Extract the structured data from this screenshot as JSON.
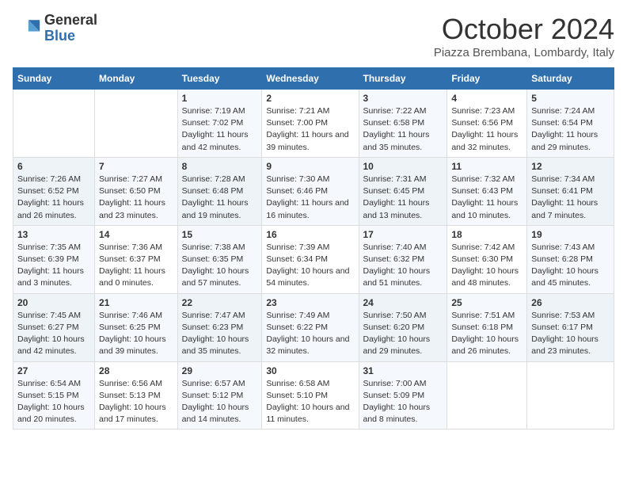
{
  "header": {
    "logo_general": "General",
    "logo_blue": "Blue",
    "month_title": "October 2024",
    "location": "Piazza Brembana, Lombardy, Italy"
  },
  "days_of_week": [
    "Sunday",
    "Monday",
    "Tuesday",
    "Wednesday",
    "Thursday",
    "Friday",
    "Saturday"
  ],
  "weeks": [
    [
      {
        "day": "",
        "info": ""
      },
      {
        "day": "",
        "info": ""
      },
      {
        "day": "1",
        "info": "Sunrise: 7:19 AM\nSunset: 7:02 PM\nDaylight: 11 hours and 42 minutes."
      },
      {
        "day": "2",
        "info": "Sunrise: 7:21 AM\nSunset: 7:00 PM\nDaylight: 11 hours and 39 minutes."
      },
      {
        "day": "3",
        "info": "Sunrise: 7:22 AM\nSunset: 6:58 PM\nDaylight: 11 hours and 35 minutes."
      },
      {
        "day": "4",
        "info": "Sunrise: 7:23 AM\nSunset: 6:56 PM\nDaylight: 11 hours and 32 minutes."
      },
      {
        "day": "5",
        "info": "Sunrise: 7:24 AM\nSunset: 6:54 PM\nDaylight: 11 hours and 29 minutes."
      }
    ],
    [
      {
        "day": "6",
        "info": "Sunrise: 7:26 AM\nSunset: 6:52 PM\nDaylight: 11 hours and 26 minutes."
      },
      {
        "day": "7",
        "info": "Sunrise: 7:27 AM\nSunset: 6:50 PM\nDaylight: 11 hours and 23 minutes."
      },
      {
        "day": "8",
        "info": "Sunrise: 7:28 AM\nSunset: 6:48 PM\nDaylight: 11 hours and 19 minutes."
      },
      {
        "day": "9",
        "info": "Sunrise: 7:30 AM\nSunset: 6:46 PM\nDaylight: 11 hours and 16 minutes."
      },
      {
        "day": "10",
        "info": "Sunrise: 7:31 AM\nSunset: 6:45 PM\nDaylight: 11 hours and 13 minutes."
      },
      {
        "day": "11",
        "info": "Sunrise: 7:32 AM\nSunset: 6:43 PM\nDaylight: 11 hours and 10 minutes."
      },
      {
        "day": "12",
        "info": "Sunrise: 7:34 AM\nSunset: 6:41 PM\nDaylight: 11 hours and 7 minutes."
      }
    ],
    [
      {
        "day": "13",
        "info": "Sunrise: 7:35 AM\nSunset: 6:39 PM\nDaylight: 11 hours and 3 minutes."
      },
      {
        "day": "14",
        "info": "Sunrise: 7:36 AM\nSunset: 6:37 PM\nDaylight: 11 hours and 0 minutes."
      },
      {
        "day": "15",
        "info": "Sunrise: 7:38 AM\nSunset: 6:35 PM\nDaylight: 10 hours and 57 minutes."
      },
      {
        "day": "16",
        "info": "Sunrise: 7:39 AM\nSunset: 6:34 PM\nDaylight: 10 hours and 54 minutes."
      },
      {
        "day": "17",
        "info": "Sunrise: 7:40 AM\nSunset: 6:32 PM\nDaylight: 10 hours and 51 minutes."
      },
      {
        "day": "18",
        "info": "Sunrise: 7:42 AM\nSunset: 6:30 PM\nDaylight: 10 hours and 48 minutes."
      },
      {
        "day": "19",
        "info": "Sunrise: 7:43 AM\nSunset: 6:28 PM\nDaylight: 10 hours and 45 minutes."
      }
    ],
    [
      {
        "day": "20",
        "info": "Sunrise: 7:45 AM\nSunset: 6:27 PM\nDaylight: 10 hours and 42 minutes."
      },
      {
        "day": "21",
        "info": "Sunrise: 7:46 AM\nSunset: 6:25 PM\nDaylight: 10 hours and 39 minutes."
      },
      {
        "day": "22",
        "info": "Sunrise: 7:47 AM\nSunset: 6:23 PM\nDaylight: 10 hours and 35 minutes."
      },
      {
        "day": "23",
        "info": "Sunrise: 7:49 AM\nSunset: 6:22 PM\nDaylight: 10 hours and 32 minutes."
      },
      {
        "day": "24",
        "info": "Sunrise: 7:50 AM\nSunset: 6:20 PM\nDaylight: 10 hours and 29 minutes."
      },
      {
        "day": "25",
        "info": "Sunrise: 7:51 AM\nSunset: 6:18 PM\nDaylight: 10 hours and 26 minutes."
      },
      {
        "day": "26",
        "info": "Sunrise: 7:53 AM\nSunset: 6:17 PM\nDaylight: 10 hours and 23 minutes."
      }
    ],
    [
      {
        "day": "27",
        "info": "Sunrise: 6:54 AM\nSunset: 5:15 PM\nDaylight: 10 hours and 20 minutes."
      },
      {
        "day": "28",
        "info": "Sunrise: 6:56 AM\nSunset: 5:13 PM\nDaylight: 10 hours and 17 minutes."
      },
      {
        "day": "29",
        "info": "Sunrise: 6:57 AM\nSunset: 5:12 PM\nDaylight: 10 hours and 14 minutes."
      },
      {
        "day": "30",
        "info": "Sunrise: 6:58 AM\nSunset: 5:10 PM\nDaylight: 10 hours and 11 minutes."
      },
      {
        "day": "31",
        "info": "Sunrise: 7:00 AM\nSunset: 5:09 PM\nDaylight: 10 hours and 8 minutes."
      },
      {
        "day": "",
        "info": ""
      },
      {
        "day": "",
        "info": ""
      }
    ]
  ]
}
